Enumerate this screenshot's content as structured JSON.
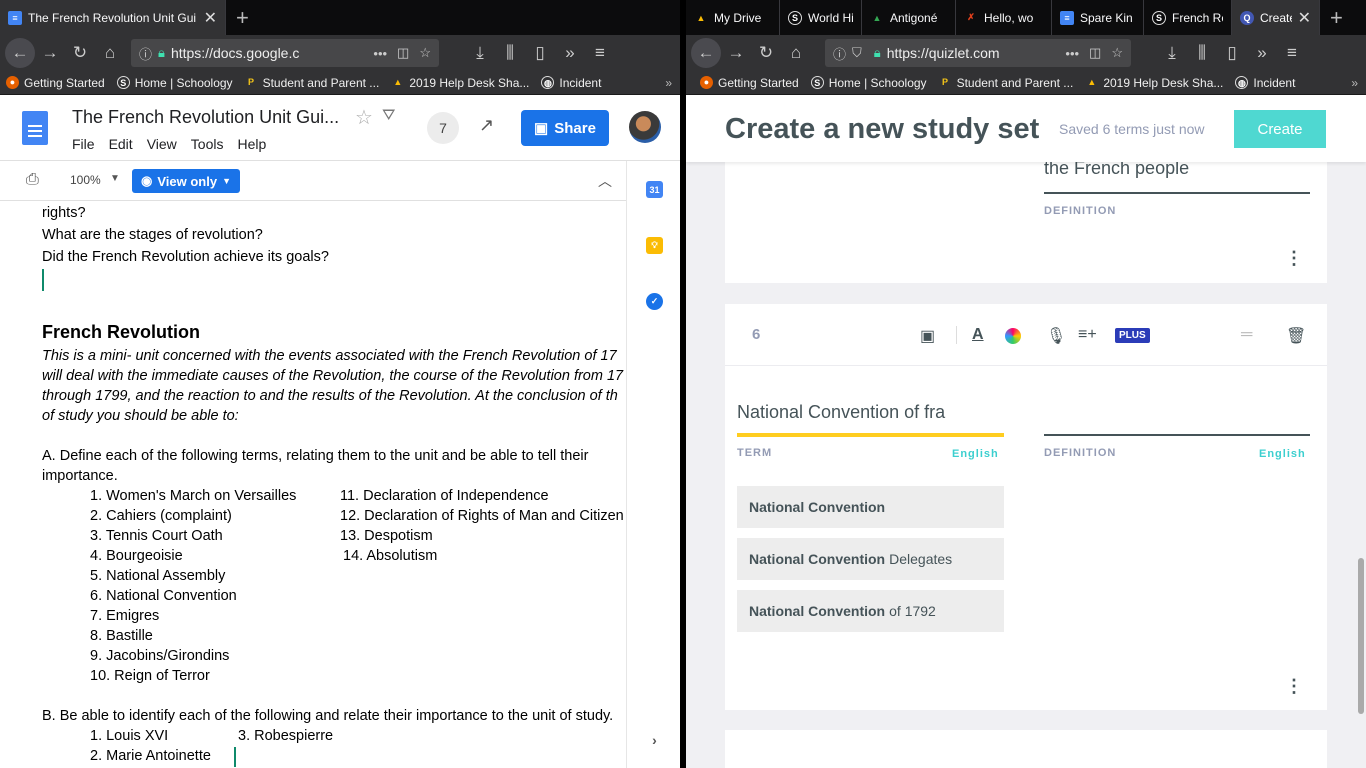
{
  "left_browser": {
    "tabs": [
      {
        "title": "The French Revolution Unit Gui",
        "active": true
      }
    ],
    "url": "https://docs.google.c",
    "bookmarks": [
      "Getting Started",
      "Home | Schoology",
      "Student and Parent ...",
      "2019 Help Desk Sha...",
      "Incident"
    ]
  },
  "right_browser": {
    "tabs": [
      {
        "title": "My Drive"
      },
      {
        "title": "World His"
      },
      {
        "title": "Antigoné"
      },
      {
        "title": "Hello, wo"
      },
      {
        "title": "Spare Kin"
      },
      {
        "title": "French Re"
      },
      {
        "title": "Create",
        "active": true
      }
    ],
    "url": "https://quizlet.com",
    "bookmarks": [
      "Getting Started",
      "Home | Schoology",
      "Student and Parent ...",
      "2019 Help Desk Sha...",
      "Incident"
    ]
  },
  "docs": {
    "title": "The French Revolution Unit Gui...",
    "menu": [
      "File",
      "Edit",
      "View",
      "Tools",
      "Help"
    ],
    "viewer_count": "7",
    "share_label": "Share",
    "zoom": "100%",
    "view_only_label": "View only",
    "body": {
      "q1": "rights?",
      "q2": "What are the stages of revolution?",
      "q3": "Did the French Revolution achieve its goals?",
      "heading": "French Revolution",
      "intro": [
        "This is a mini- unit concerned with the events associated with the French Revolution of 17",
        "will deal with the immediate causes of the Revolution, the course of the Revolution from 17",
        "through 1799, and the reaction to and the results of the Revolution. At the conclusion of th",
        "of study you should be able to:"
      ],
      "partA": [
        "A.  Define each of the following terms, relating them to the unit and be able to tell their",
        "importance."
      ],
      "terms_left": [
        "1. Women's March on Versailles",
        "2.  Cahiers (complaint)",
        "3.  Tennis Court Oath",
        "4.  Bourgeoisie",
        "5.  National Assembly",
        "6.  National Convention",
        "7.   Emigres",
        "8.  Bastille",
        "9. Jacobins/Girondins",
        "10.  Reign of Terror"
      ],
      "terms_right": [
        "11. Declaration of Independence",
        "12.  Declaration of Rights of Man and Citizen",
        "13.  Despotism",
        "14. Absolutism"
      ],
      "partB": "B.  Be able to identify each of the following and relate their importance to the unit of study.",
      "people": [
        "1.  Louis XVI",
        "3.  Robespierre",
        "2.  Marie Antoinette"
      ]
    }
  },
  "quizlet": {
    "title": "Create a new study set",
    "saved": "Saved 6 terms just now",
    "create_label": "Create",
    "prev_card": {
      "definition_text": "the French people",
      "definition_label": "DEFINITION"
    },
    "card": {
      "number": "6",
      "plus_label": "PLUS",
      "term_value": "National Convention of fra",
      "term_label": "TERM",
      "term_lang": "English",
      "definition_label": "DEFINITION",
      "definition_lang": "English",
      "suggestions": [
        {
          "bold": "National Convention",
          "rest": ""
        },
        {
          "bold": "National Convention",
          "rest": "Delegates"
        },
        {
          "bold": "National Convention",
          "rest": "of 1792"
        }
      ]
    }
  }
}
